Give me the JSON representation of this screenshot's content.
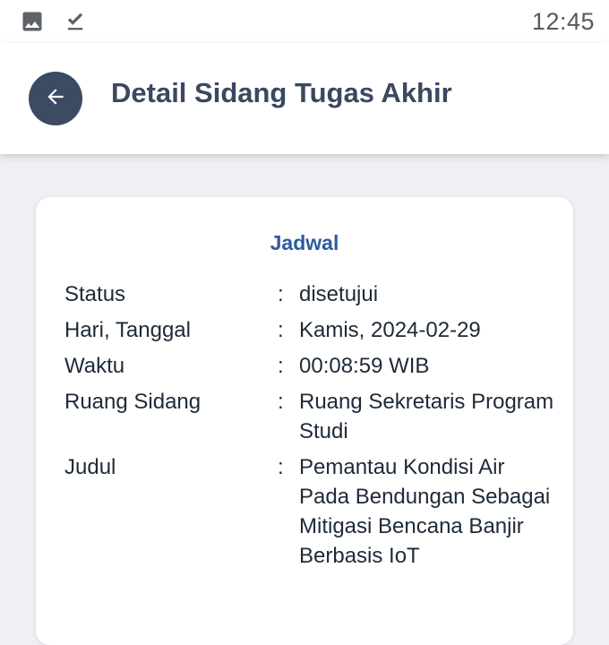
{
  "status_bar": {
    "time": "12:45",
    "left_icons": [
      "image-icon",
      "download-done-icon"
    ]
  },
  "app_bar": {
    "back_icon": "arrow-left-icon",
    "title": "Detail Sidang Tugas Akhir"
  },
  "card": {
    "title": "Jadwal",
    "separator": ":",
    "rows": [
      {
        "label": "Status",
        "value": "disetujui"
      },
      {
        "label": "Hari, Tanggal",
        "value": "Kamis, 2024-02-29"
      },
      {
        "label": "Waktu",
        "value": "00:08:59 WIB"
      },
      {
        "label": "Ruang Sidang",
        "value": "Ruang Sekretaris Program Studi"
      },
      {
        "label": "Judul",
        "value": "Pemantau Kondisi Air Pada Bendungan Sebagai Mitigasi Bencana Banjir Berbasis IoT"
      }
    ]
  },
  "colors": {
    "title_text": "#3a4860",
    "back_button": "#3c4a64",
    "card_title": "#2f5aa0",
    "background": "#eff0f3"
  }
}
